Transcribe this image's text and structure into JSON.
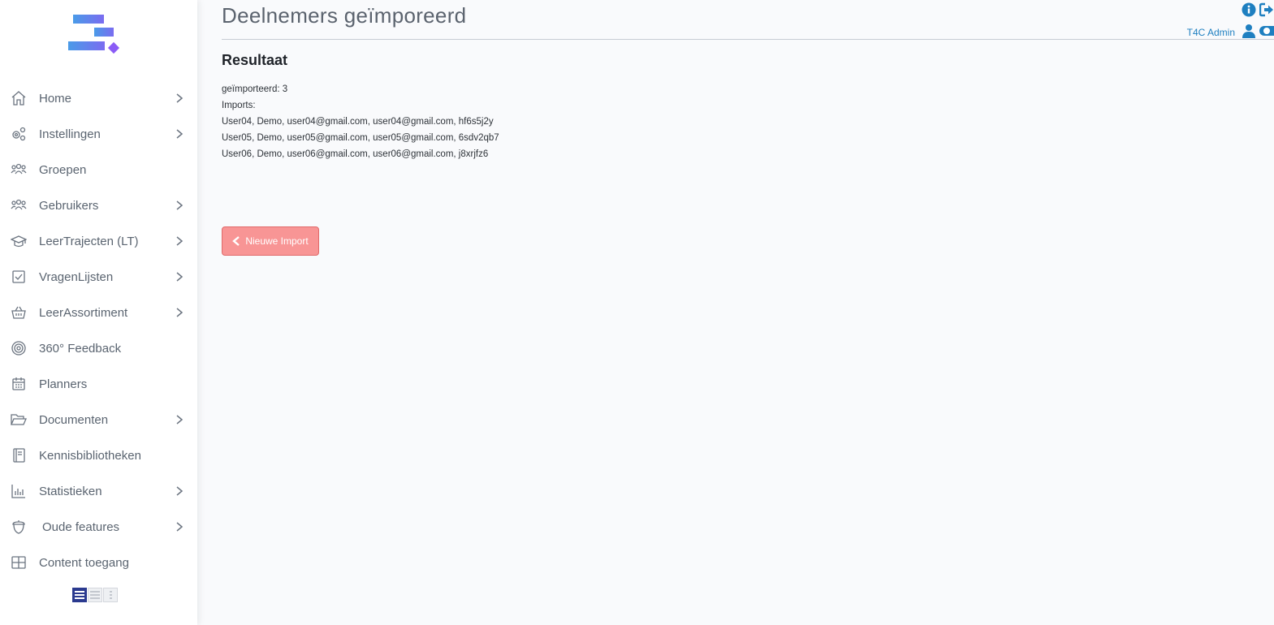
{
  "header": {
    "title": "Deelnemers geïmporeerd",
    "user_name": "T4C Admin",
    "icons": [
      "info-icon",
      "logout-icon",
      "user-icon",
      "toggle-icon"
    ]
  },
  "colors": {
    "accent_blue": "#1e7fc0",
    "button_red": "#f89595",
    "logo_blue": "#4a90e2",
    "logo_purple": "#8b5cf6"
  },
  "sidebar": {
    "items": [
      {
        "label": "Home",
        "icon": "home-icon",
        "has_submenu": true
      },
      {
        "label": "Instellingen",
        "icon": "settings-icon",
        "has_submenu": true
      },
      {
        "label": "Groepen",
        "icon": "groups-icon",
        "has_submenu": false
      },
      {
        "label": "Gebruikers",
        "icon": "users-icon",
        "has_submenu": true
      },
      {
        "label": "LeerTrajecten (LT)",
        "icon": "graduation-cap-icon",
        "has_submenu": true
      },
      {
        "label": "VragenLijsten",
        "icon": "checkbox-icon",
        "has_submenu": true
      },
      {
        "label": "LeerAssortiment",
        "icon": "basket-icon",
        "has_submenu": true
      },
      {
        "label": "360° Feedback",
        "icon": "target-icon",
        "has_submenu": false
      },
      {
        "label": "Planners",
        "icon": "calendar-icon",
        "has_submenu": false
      },
      {
        "label": "Documenten",
        "icon": "folder-open-icon",
        "has_submenu": true
      },
      {
        "label": "Kennisbibliotheken",
        "icon": "book-icon",
        "has_submenu": false
      },
      {
        "label": "Statistieken",
        "icon": "bar-chart-icon",
        "has_submenu": true
      },
      {
        "label": "Oude features",
        "icon": "acorn-icon",
        "has_submenu": true
      },
      {
        "label": "Content toegang",
        "icon": "grid-icon",
        "has_submenu": false
      }
    ],
    "view_modes": [
      "list-view-icon",
      "compact-view-icon",
      "column-view-icon"
    ]
  },
  "main": {
    "section_title": "Resultaat",
    "imported_count": "geïmporteerd: 3",
    "imports_label": "Imports:",
    "imports": [
      "User04, Demo, user04@gmail.com, user04@gmail.com, hf6s5j2y",
      "User05, Demo, user05@gmail.com, user05@gmail.com, 6sdv2qb7",
      "User06, Demo, user06@gmail.com, user06@gmail.com, j8xrjfz6"
    ],
    "new_import_button": "Nieuwe Import"
  }
}
